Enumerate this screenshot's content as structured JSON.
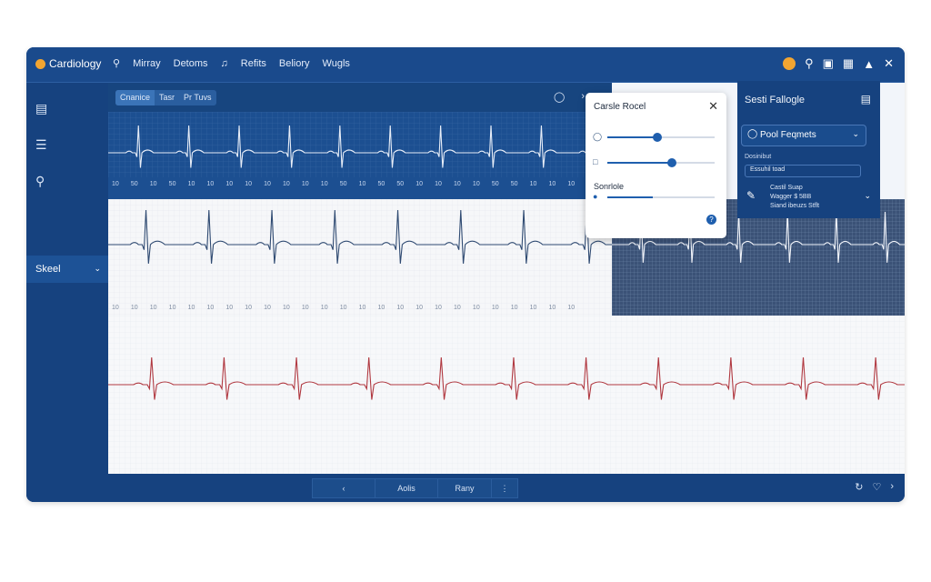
{
  "app": {
    "title": "Cardiology"
  },
  "nav": {
    "items": [
      "Mirray",
      "Detoms",
      "Refits",
      "Beliory",
      "Wugls"
    ]
  },
  "tabs": [
    "Cnanice",
    "Tasr",
    "Pr Tuvs"
  ],
  "popover": {
    "title": "Carsle Rocel",
    "section_label": "Sonrlole",
    "sliders": [
      {
        "value": 0.47
      },
      {
        "value": 0.6
      },
      {
        "value": 0.42
      }
    ]
  },
  "right_panel": {
    "title": "Sesti Fallogle",
    "select_value": "Pool Feqmets",
    "sub_label": "Dosinibut",
    "input_value": "Essuhil toad",
    "info_lines": [
      "Castil Suap",
      "Wagger $ 5BB",
      "Siand ibeuzs Stflt"
    ]
  },
  "sidebar": {
    "active_label": "Skeel"
  },
  "bottom": {
    "buttons": [
      "Aolis",
      "Rany"
    ]
  },
  "ticks": {
    "strip1": [
      "10",
      "50",
      "10",
      "50",
      "10",
      "10",
      "10",
      "10",
      "10",
      "10",
      "10",
      "10",
      "50",
      "10",
      "50",
      "50",
      "10",
      "10",
      "10",
      "10",
      "50",
      "50",
      "10",
      "10",
      "10"
    ],
    "strip2": [
      "10",
      "10",
      "10",
      "10",
      "10",
      "10",
      "10",
      "10",
      "10",
      "10",
      "10",
      "10",
      "10",
      "10",
      "10",
      "10",
      "10",
      "10",
      "10",
      "10",
      "10",
      "10",
      "10",
      "10",
      "10"
    ]
  },
  "colors": {
    "primary": "#16427f",
    "accent": "#f2a531",
    "ecg_red": "#b03840",
    "ecg_blue": "#2f4a72"
  }
}
